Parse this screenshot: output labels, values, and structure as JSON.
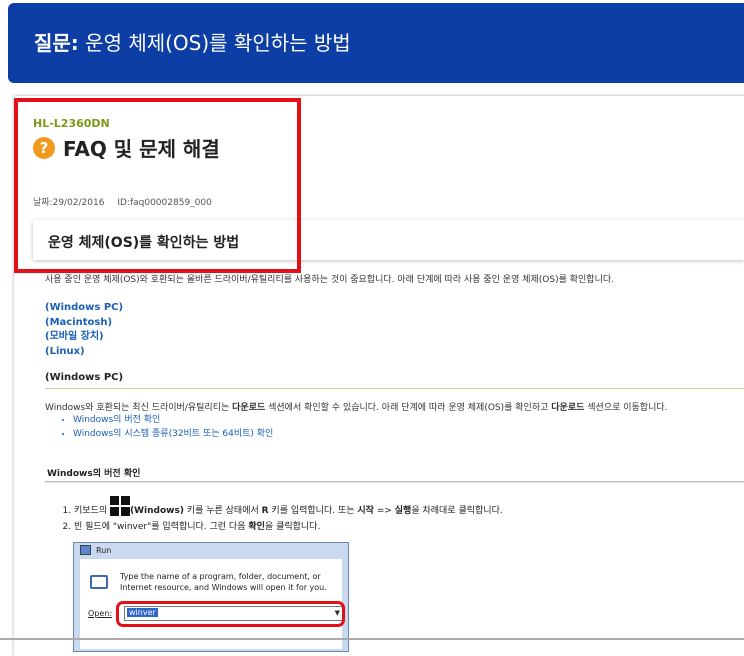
{
  "banner": {
    "label": "질문:",
    "title": "운영 체제(OS)를 확인하는 방법"
  },
  "faq": {
    "model": "HL-L2360DN",
    "heading": "FAQ 및 문제 해결",
    "date_label": "날짜:29/02/2016",
    "id_label": "ID:faq00002859_000",
    "section_title": "운영 체제(OS)를 확인하는 방법"
  },
  "content": {
    "intro": "사용 중인 운영 체제(OS)와 호환되는 올바른 드라이버/유틸리티를 사용하는 것이 중요합니다. 아래 단계에 따라 사용 중인 운영 체제(OS)를 확인합니다.",
    "links": [
      "(Windows PC)",
      "(Macintosh)",
      "(모바일 장치)",
      "(Linux)"
    ],
    "windows_heading": "(Windows PC)",
    "windows_desc_pre": "Windows와 호환되는 최신 드라이버/유틸리티는 ",
    "windows_desc_b1": "다운로드",
    "windows_desc_mid": " 섹션에서 확인할 수 있습니다. 아래 단계에 따라 운영 체제(OS)를 확인하고 ",
    "windows_desc_b2": "다운로드",
    "windows_desc_post": " 섹션으로 이동합니다.",
    "bullets": [
      "Windows의 버전 확인",
      "Windows의 시스템 종류(32비트 또는 64비트) 확인"
    ],
    "version_heading": "Windows의 버전 확인",
    "step1_pre": "키보드의 ",
    "step1_win": "(Windows)",
    "step1_mid": " 키를 누른 상태에서 ",
    "step1_r": "R",
    "step1_post": " 키를 입력합니다. 또는 ",
    "step1_start": "시작",
    "step1_arrow": " => ",
    "step1_run": "실행",
    "step1_end": "을 차례대로 클릭합니다.",
    "step2_pre": "빈 필드에 \"winver\"를 입력합니다. 그런 다음 ",
    "step2_b": "확인",
    "step2_post": "을 클릭합니다."
  },
  "run_dialog": {
    "title": "Run",
    "text": "Type the name of a program, folder, document, or Internet resource, and Windows will open it for you.",
    "open_label": "Open:",
    "input_value": "winver"
  },
  "colors": {
    "banner": "#0d3ea6",
    "highlight": "#e3101a",
    "link": "#1a5eb8",
    "model": "#7a9a1a"
  }
}
